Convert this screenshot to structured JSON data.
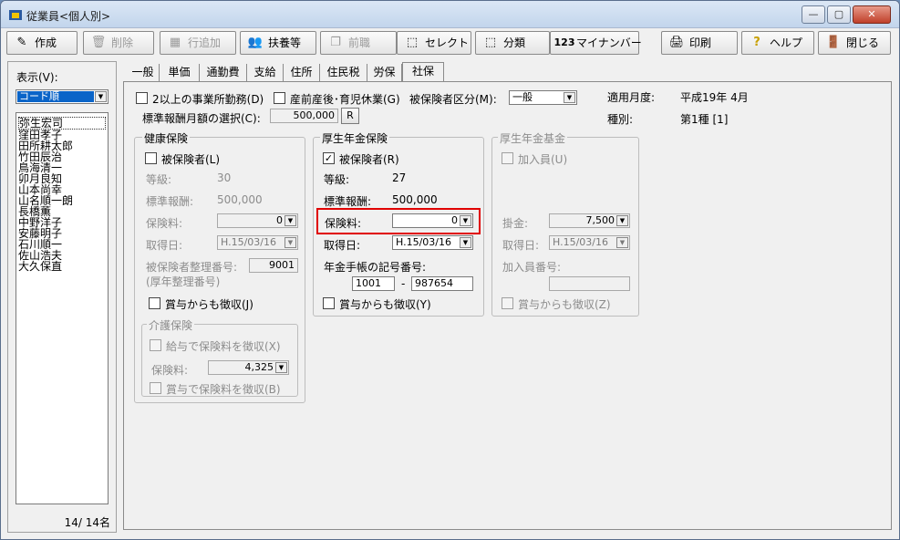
{
  "window": {
    "title": "従業員<個人別>",
    "controls": {
      "minimize": "—",
      "maximize": "▢",
      "close": "✕"
    }
  },
  "toolbar": {
    "create": "作成",
    "delete": "削除",
    "add_row": "行追加",
    "dependents": "扶養等",
    "prev_job": "前職",
    "select": "セレクト",
    "classify": "分類",
    "mynumber": "マイナンバー",
    "mynumber_prefix": "123",
    "print": "印刷",
    "help": "ヘルプ",
    "close": "閉じる"
  },
  "sidebar": {
    "display_label": "表示(V):",
    "sort_value": "コード順",
    "employees": [
      "弥生宏司",
      "窪田孝子",
      "田所耕太郎",
      "竹田辰治",
      "鳥海清一",
      "卯月良知",
      "山本尚幸",
      "山名順一朗",
      "長橋薫",
      "中野洋子",
      "安藤明子",
      "石川順一",
      "佐山浩夫",
      "大久保直"
    ],
    "count": "14/ 14名"
  },
  "tabs": [
    "一般",
    "単価",
    "通勤費",
    "支給",
    "住所",
    "住民税",
    "労保",
    "社保"
  ],
  "active_tab": "社保",
  "top": {
    "multi_office_label": "2以上の事業所勤務(D)",
    "maternity_label": "産前産後･育児休業(G)",
    "insured_class_label": "被保険者区分(M):",
    "insured_class_value": "一般",
    "standard_selection_label": "標準報酬月額の選択(C):",
    "standard_selection_value": "500,000",
    "r_button": "R",
    "apply_month_label": "適用月度:",
    "apply_month_value": "平成19年 4月",
    "type_label": "種別:",
    "type_value": "第1種 [1]"
  },
  "health": {
    "title": "健康保険",
    "insured_label": "被保険者(L)",
    "grade_label": "等級:",
    "grade_value": "30",
    "standard_label": "標準報酬:",
    "standard_value": "500,000",
    "premium_label": "保険料:",
    "premium_value": "0",
    "acquire_label": "取得日:",
    "acquire_value": "H.15/03/16",
    "number_label": "被保険者整理番号:",
    "number_value": "9001",
    "number_sub": "(厚年整理番号)",
    "bonus_label": "賞与からも徴収(J)"
  },
  "nursing": {
    "title": "介護保険",
    "salary_label": "給与で保険料を徴収(X)",
    "premium_label": "保険料:",
    "premium_value": "4,325",
    "bonus_label": "賞与で保険料を徴収(B)"
  },
  "pension": {
    "title": "厚生年金保険",
    "insured_label": "被保険者(R)",
    "grade_label": "等級:",
    "grade_value": "27",
    "standard_label": "標準報酬:",
    "standard_value": "500,000",
    "premium_label": "保険料:",
    "premium_value": "0",
    "acquire_label": "取得日:",
    "acquire_value": "H.15/03/16",
    "book_label": "年金手帳の記号番号:",
    "book_code": "1001",
    "book_dash": "-",
    "book_number": "987654",
    "bonus_label": "賞与からも徴収(Y)"
  },
  "fund": {
    "title": "厚生年金基金",
    "join_label": "加入員(U)",
    "payment_label": "掛金:",
    "payment_value": "7,500",
    "acquire_label": "取得日:",
    "acquire_value": "H.15/03/16",
    "member_no_label": "加入員番号:",
    "member_no_value": "",
    "bonus_label": "賞与からも徴収(Z)"
  }
}
